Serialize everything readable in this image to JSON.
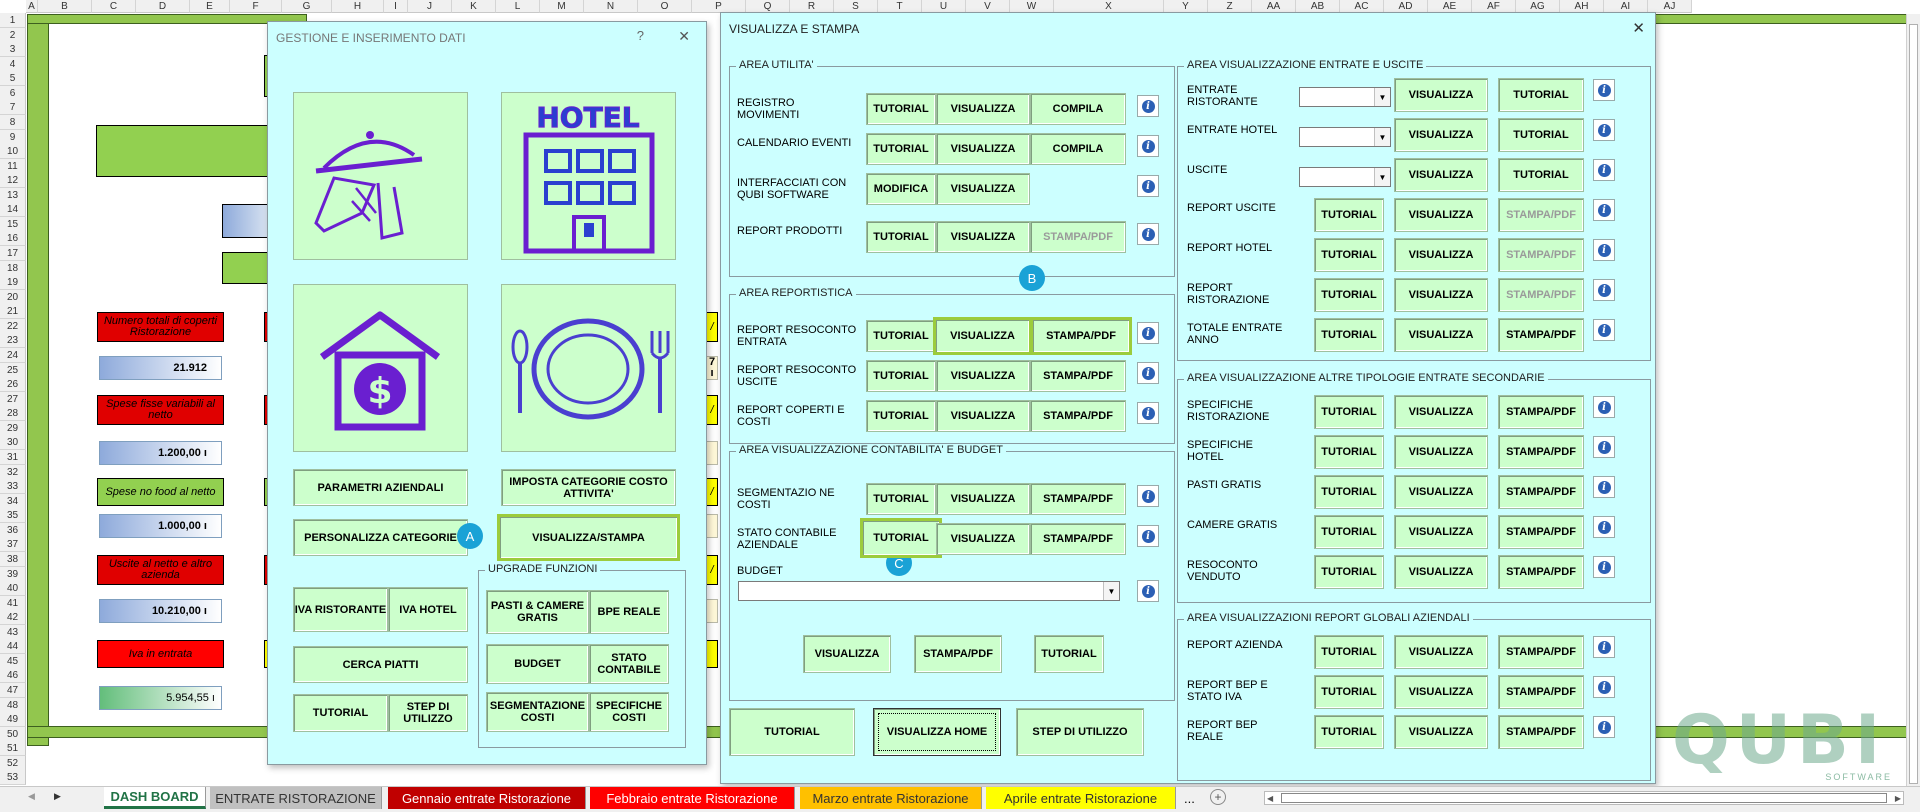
{
  "columns": [
    "A",
    "B",
    "C",
    "D",
    "E",
    "F",
    "G",
    "H",
    "I",
    "J",
    "K",
    "L",
    "M",
    "N",
    "O",
    "P",
    "Q",
    "R",
    "S",
    "T",
    "U",
    "V",
    "W",
    "X",
    "Y",
    "Z",
    "AA",
    "AB",
    "AC",
    "AD",
    "AE",
    "AF",
    "AG",
    "AH",
    "AI",
    "AJ"
  ],
  "rows": [
    "1",
    "2",
    "3",
    "4",
    "5",
    "6",
    "7",
    "8",
    "9",
    "10",
    "11",
    "12",
    "13",
    "14",
    "15",
    "16",
    "17",
    "18",
    "19",
    "20",
    "21",
    "22",
    "23",
    "24",
    "25",
    "26",
    "27",
    "28",
    "29",
    "30",
    "31",
    "32",
    "33",
    "34",
    "35",
    "36",
    "37",
    "38",
    "39",
    "40",
    "41",
    "42",
    "43",
    "44",
    "45",
    "46",
    "47",
    "48",
    "49",
    "50",
    "51",
    "52",
    "53"
  ],
  "sheet_cells": {
    "c20": "Numero totali di coperti Ristorazione",
    "c23": "21.912",
    "c26": "Spese fisse variabili al netto",
    "c29": "1.200,00 ı",
    "c32": "Spese no food al netto",
    "c35": "1.000,00 ı",
    "c38": "Uscite al netto e altro azienda",
    "c41": "10.210,00 ı",
    "c44": "Iva in entrata",
    "c47": "5.954,55 ı",
    "edge1": "/",
    "edge2": "7 ı",
    "edge3": "/",
    "edge4": "/",
    "edge5": "/"
  },
  "left_dialog": {
    "title": "GESTIONE E INSERIMENTO DATI",
    "help": "?",
    "close": "✕",
    "tiles": {
      "restaurant_icon": "serving-tray-icon",
      "hotel_icon": "hotel-building-icon",
      "hotel_sign": "HOTEL",
      "money_icon": "house-dollar-icon",
      "dollar_sign": "$",
      "cutlery_icon": "plate-cutlery-icon"
    },
    "buttons": {
      "parametri": "PARAMETRI AZIENDALI",
      "imposta": "IMPOSTA CATEGORIE COSTO ATTIVITA'",
      "personalizza": "PERSONALIZZA CATEGORIE",
      "visualizza_stampa": "VISUALIZZA/STAMPA",
      "iva_ristorante": "IVA RISTORANTE",
      "iva_hotel": "IVA HOTEL",
      "cerca_piatti": "CERCA PIATTI",
      "tutorial": "TUTORIAL",
      "step": "STEP DI UTILIZZO",
      "pasti_camere": "PASTI & CAMERE GRATIS",
      "bpe_reale": "BPE REALE",
      "budget": "BUDGET",
      "stato_contabile": "STATO CONTABILE",
      "segmentazione": "SEGMENTAZIONE COSTI",
      "specifiche_costi": "SPECIFICHE COSTI"
    },
    "upgrade_label": "UPGRADE FUNZIONI",
    "marker_a": "A"
  },
  "right_dialog": {
    "title": "VISUALIZZA E STAMPA",
    "close": "✕",
    "area_utilita": {
      "label": "AREA UTILITA'",
      "rows": [
        {
          "label": "REGISTRO MOVIMENTI",
          "b1": "TUTORIAL",
          "b2": "VISUALIZZA",
          "b3": "COMPILA"
        },
        {
          "label": "CALENDARIO EVENTI",
          "b1": "TUTORIAL",
          "b2": "VISUALIZZA",
          "b3": "COMPILA"
        },
        {
          "label": "INTERFACCIATI CON QUBI SOFTWARE",
          "b1": "MODIFICA",
          "b2": "VISUALIZZA"
        },
        {
          "label": "REPORT PRODOTTI",
          "b1": "TUTORIAL",
          "b2": "VISUALIZZA",
          "b3": "STAMPA/PDF"
        }
      ]
    },
    "area_reportistica": {
      "label": "AREA REPORTISTICA",
      "rows": [
        {
          "label": "REPORT RESOCONTO ENTRATA",
          "b1": "TUTORIAL",
          "b2": "VISUALIZZA",
          "b3": "STAMPA/PDF"
        },
        {
          "label": "REPORT RESOCONTO USCITE",
          "b1": "TUTORIAL",
          "b2": "VISUALIZZA",
          "b3": "STAMPA/PDF"
        },
        {
          "label": "REPORT COPERTI E COSTI",
          "b1": "TUTORIAL",
          "b2": "VISUALIZZA",
          "b3": "STAMPA/PDF"
        }
      ],
      "marker_b": "B"
    },
    "area_contabilita": {
      "label": "AREA VISUALIZZAZIONE CONTABILITA' E BUDGET",
      "rows": [
        {
          "label": "SEGMENTAZIO NE COSTI",
          "b1": "TUTORIAL",
          "b2": "VISUALIZZA",
          "b3": "STAMPA/PDF"
        },
        {
          "label": "STATO CONTABILE AZIENDALE",
          "b1": "TUTORIAL",
          "b2": "VISUALIZZA",
          "b3": "STAMPA/PDF"
        }
      ],
      "budget_label": "BUDGET",
      "budget_value": "",
      "visualizza": "VISUALIZZA",
      "stampa": "STAMPA/PDF",
      "tutorial": "TUTORIAL",
      "marker_c": "C"
    },
    "bottom": {
      "tutorial": "TUTORIAL",
      "visualizza_home": "VISUALIZZA HOME",
      "step": "STEP DI UTILIZZO"
    },
    "area_entrate_uscite": {
      "label": "AREA VISUALIZZAZIONE ENTRATE E USCITE",
      "combo_rows": [
        {
          "label": "ENTRATE RISTORANTE",
          "value": "",
          "b2": "VISUALIZZA",
          "b3": "TUTORIAL"
        },
        {
          "label": "ENTRATE HOTEL",
          "value": "",
          "b2": "VISUALIZZA",
          "b3": "TUTORIAL"
        },
        {
          "label": "USCITE",
          "value": "",
          "b2": "VISUALIZZA",
          "b3": "TUTORIAL"
        }
      ],
      "rows": [
        {
          "label": "REPORT USCITE",
          "b1": "TUTORIAL",
          "b2": "VISUALIZZA",
          "b3": "STAMPA/PDF"
        },
        {
          "label": "REPORT HOTEL",
          "b1": "TUTORIAL",
          "b2": "VISUALIZZA",
          "b3": "STAMPA/PDF"
        },
        {
          "label": "REPORT RISTORAZIONE",
          "b1": "TUTORIAL",
          "b2": "VISUALIZZA",
          "b3": "STAMPA/PDF"
        },
        {
          "label": "TOTALE ENTRATE ANNO",
          "b1": "TUTORIAL",
          "b2": "VISUALIZZA",
          "b3": "STAMPA/PDF"
        }
      ]
    },
    "area_altre": {
      "label": "AREA VISUALIZZAZIONE ALTRE TIPOLOGIE ENTRATE SECONDARIE",
      "rows": [
        {
          "label": "SPECIFICHE RISTORAZIONE",
          "b1": "TUTORIAL",
          "b2": "VISUALIZZA",
          "b3": "STAMPA/PDF"
        },
        {
          "label": "SPECIFICHE HOTEL",
          "b1": "TUTORIAL",
          "b2": "VISUALIZZA",
          "b3": "STAMPA/PDF"
        },
        {
          "label": "PASTI GRATIS",
          "b1": "TUTORIAL",
          "b2": "VISUALIZZA",
          "b3": "STAMPA/PDF"
        },
        {
          "label": "CAMERE GRATIS",
          "b1": "TUTORIAL",
          "b2": "VISUALIZZA",
          "b3": "STAMPA/PDF"
        },
        {
          "label": "RESOCONTO VENDUTO",
          "b1": "TUTORIAL",
          "b2": "VISUALIZZA",
          "b3": "STAMPA/PDF"
        }
      ]
    },
    "area_globali": {
      "label": "AREA VISUALIZZAZIONI REPORT GLOBALI AZIENDALI",
      "rows": [
        {
          "label": "REPORT AZIENDA",
          "b1": "TUTORIAL",
          "b2": "VISUALIZZA",
          "b3": "STAMPA/PDF"
        },
        {
          "label": "REPORT BEP E STATO IVA",
          "b1": "TUTORIAL",
          "b2": "VISUALIZZA",
          "b3": "STAMPA/PDF"
        },
        {
          "label": "REPORT BEP REALE",
          "b1": "TUTORIAL",
          "b2": "VISUALIZZA",
          "b3": "STAMPA/PDF"
        }
      ]
    },
    "info_glyph": "i"
  },
  "logo": {
    "text": "QUBI",
    "sub": "SOFTWARE"
  },
  "sheet_tabs": {
    "nav_prev": "◀",
    "nav_next": "▶",
    "tabs": [
      "DASH BOARD",
      "ENTRATE RISTORAZIONE",
      "Gennaio entrate Ristorazione",
      "Febbraio entrate Ristorazione",
      "Marzo entrate Ristorazione",
      "Aprile entrate Ristorazione"
    ],
    "more": "...",
    "add": "+"
  },
  "colors": {
    "dialog_bg": "#ccffff",
    "button_bg": "#ccffcc",
    "highlight": "#9ccc3c",
    "marker": "#1aa2d6",
    "icon_purple": "#6a1fd0",
    "sheet_green": "#92c64e",
    "sheet_red": "#e00000"
  }
}
